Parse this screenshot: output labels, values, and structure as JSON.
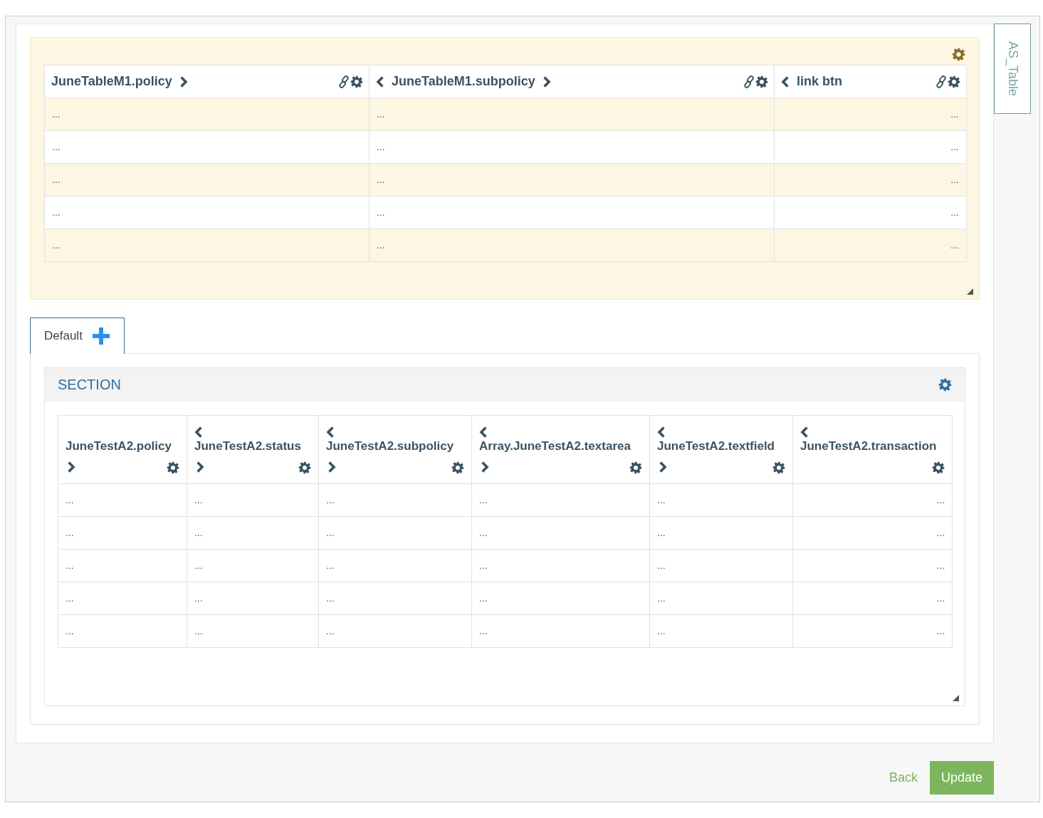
{
  "side_tab": {
    "label": "AS_Table"
  },
  "top_table": {
    "columns": [
      {
        "label": "JuneTableM1.policy",
        "prev_arrow": false,
        "next_arrow": true,
        "link": true
      },
      {
        "label": "JuneTableM1.subpolicy",
        "prev_arrow": true,
        "next_arrow": true,
        "link": true
      },
      {
        "label": "link btn",
        "prev_arrow": true,
        "next_arrow": false,
        "link": true
      }
    ],
    "rows": [
      [
        "...",
        "...",
        "..."
      ],
      [
        "...",
        "...",
        "..."
      ],
      [
        "...",
        "...",
        "..."
      ],
      [
        "...",
        "...",
        "..."
      ],
      [
        "...",
        "...",
        "..."
      ]
    ]
  },
  "tabs": [
    {
      "label": "Default",
      "selected": true
    }
  ],
  "section": {
    "title": "SECTION",
    "table": {
      "columns": [
        {
          "label": "JuneTestA2.policy",
          "prev_arrow": false,
          "next_arrow": true
        },
        {
          "label": "JuneTestA2.status",
          "prev_arrow": true,
          "next_arrow": true
        },
        {
          "label": "JuneTestA2.subpolicy",
          "prev_arrow": true,
          "next_arrow": true
        },
        {
          "label": "Array.JuneTestA2.textarea",
          "prev_arrow": true,
          "next_arrow": true
        },
        {
          "label": "JuneTestA2.textfield",
          "prev_arrow": true,
          "next_arrow": true
        },
        {
          "label": "JuneTestA2.transaction",
          "prev_arrow": true,
          "next_arrow": false
        }
      ],
      "rows": [
        [
          "...",
          "...",
          "...",
          "...",
          "...",
          "..."
        ],
        [
          "...",
          "...",
          "...",
          "...",
          "...",
          "..."
        ],
        [
          "...",
          "...",
          "...",
          "...",
          "...",
          "..."
        ],
        [
          "...",
          "...",
          "...",
          "...",
          "...",
          "..."
        ],
        [
          "...",
          "...",
          "...",
          "...",
          "...",
          "..."
        ]
      ]
    }
  },
  "buttons": [
    {
      "label": "Back",
      "kind": "link"
    },
    {
      "label": "Update",
      "kind": "primary"
    }
  ]
}
